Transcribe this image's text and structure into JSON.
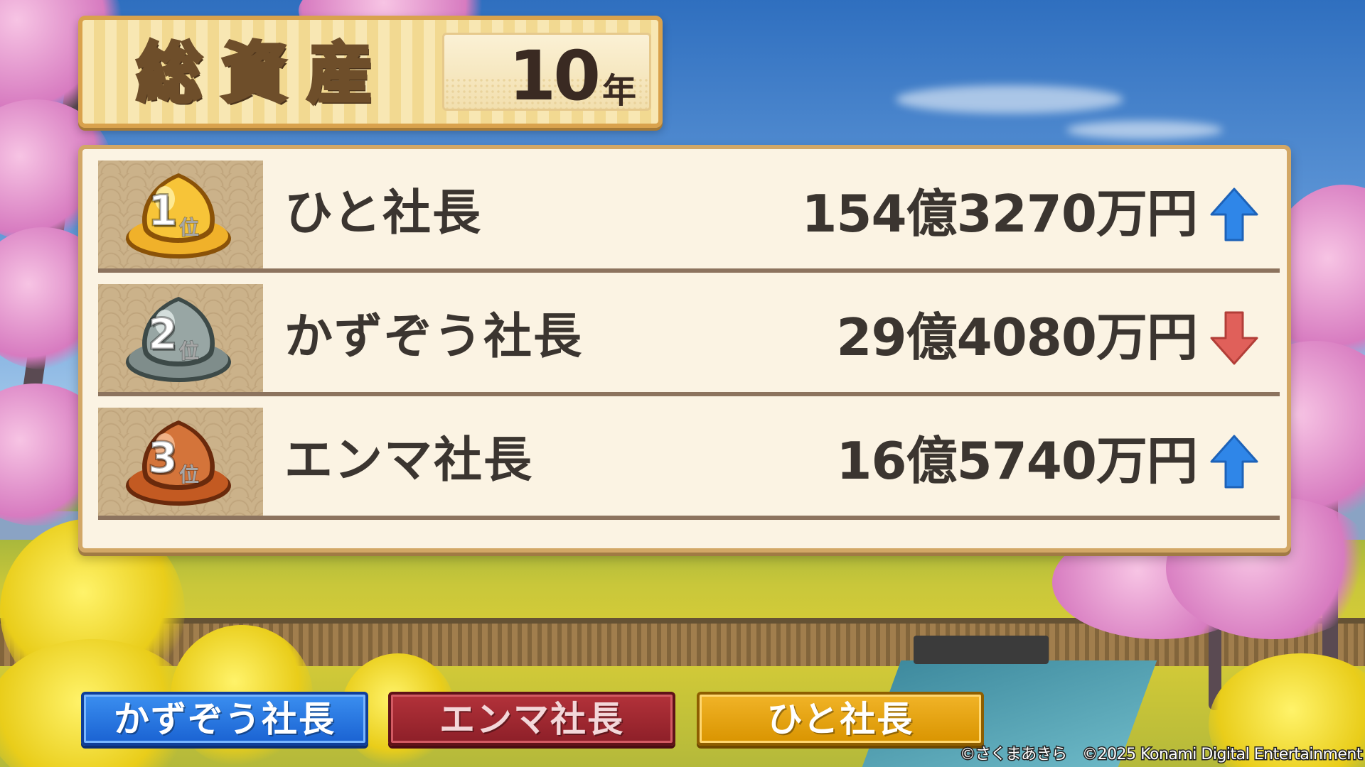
{
  "header": {
    "title": "総資産",
    "year_number": "10",
    "year_unit": "年"
  },
  "ranking": [
    {
      "rank": "1",
      "rank_unit": "位",
      "name": "ひと社長",
      "amount": "154億3270万円",
      "trend": "up",
      "badge_color": "#e9a81c"
    },
    {
      "rank": "2",
      "rank_unit": "位",
      "name": "かずぞう社長",
      "amount": "29億4080万円",
      "trend": "down",
      "badge_color": "#8b9896"
    },
    {
      "rank": "3",
      "rank_unit": "位",
      "name": "エンマ社長",
      "amount": "16億5740万円",
      "trend": "up",
      "badge_color": "#c8642a"
    }
  ],
  "players": [
    {
      "name": "かずぞう社長",
      "color": "#1f6fdc"
    },
    {
      "name": "エンマ社長",
      "color": "#a02830"
    },
    {
      "name": "ひと社長",
      "color": "#e5a010"
    }
  ],
  "colors": {
    "up_arrow": "#2f86e8",
    "down_arrow": "#e0605a"
  },
  "copyright": "©さくまあきら　©2025 Konami Digital Entertainment"
}
